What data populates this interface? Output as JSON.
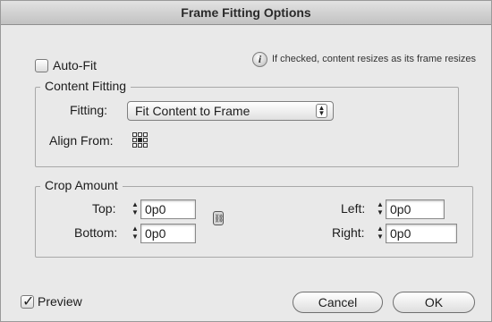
{
  "window": {
    "title": "Frame Fitting Options"
  },
  "auto_fit": {
    "label": "Auto-Fit",
    "checked": false
  },
  "info": {
    "icon": "info-icon",
    "text": "If checked, content resizes as its frame resizes"
  },
  "content_fitting": {
    "group_title": "Content Fitting",
    "fitting_label": "Fitting:",
    "fitting_value": "Fit Content to Frame",
    "align_from_label": "Align From:",
    "align_from_selected": "center"
  },
  "crop_amount": {
    "group_title": "Crop Amount",
    "top_label": "Top:",
    "top_value": "0p0",
    "bottom_label": "Bottom:",
    "bottom_value": "0p0",
    "left_label": "Left:",
    "left_value": "0p0",
    "right_label": "Right:",
    "right_value": "0p0"
  },
  "preview": {
    "label": "Preview",
    "checked": true
  },
  "buttons": {
    "cancel": "Cancel",
    "ok": "OK"
  }
}
